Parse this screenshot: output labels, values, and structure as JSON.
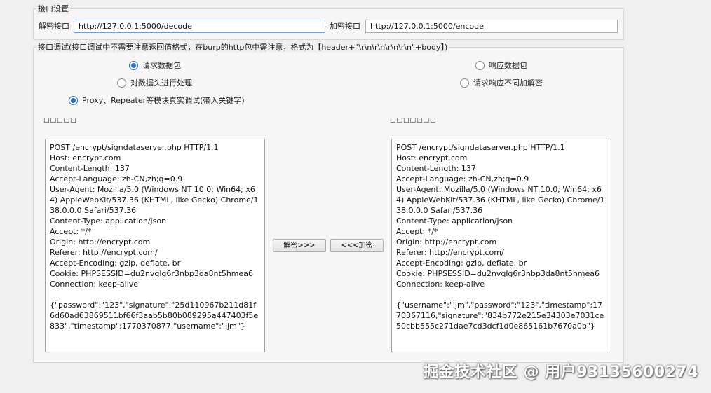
{
  "interface_settings": {
    "title": "接口设置",
    "decode_label": "解密接口",
    "decode_url": "http://127.0.0.1:5000/decode",
    "encode_label": "加密接口",
    "encode_url": "http://127.0.0.1:5000/encode"
  },
  "debug": {
    "title": "接口调试(接口调试中不需要注意返回值格式，在burp的http包中需注意，格式为【header+\"\\r\\n\\r\\n\\r\\n\\r\\n\"+body】)",
    "options": {
      "request_packet": {
        "label": "请求数据包",
        "checked": true
      },
      "response_packet": {
        "label": "响应数据包",
        "checked": false
      },
      "process_header": {
        "label": "对数据头进行处理",
        "checked": false
      },
      "request_response_different": {
        "label": "请求响应不同加解密",
        "checked": false
      },
      "proxy_repeater": {
        "label": "Proxy、Repeater等模块真实调试(带入关键字)",
        "checked": true
      }
    },
    "left_label": "□□□□□",
    "right_label": "□□□□□□□",
    "left_content": "POST /encrypt/signdataserver.php HTTP/1.1\nHost: encrypt.com\nContent-Length: 137\nAccept-Language: zh-CN,zh;q=0.9\nUser-Agent: Mozilla/5.0 (Windows NT 10.0; Win64; x64) AppleWebKit/537.36 (KHTML, like Gecko) Chrome/138.0.0.0 Safari/537.36\nContent-Type: application/json\nAccept: */*\nOrigin: http://encrypt.com\nReferer: http://encrypt.com/\nAccept-Encoding: gzip, deflate, br\nCookie: PHPSESSID=du2nvqlg6r3nbp3da8nt5hmea6\nConnection: keep-alive\n\n{\"password\":\"123\",\"signature\":\"25d110967b211d81f6d60ad63869511bf66f3aab5b80b089295a447403f5e833\",\"timestamp\":1770370877,\"username\":\"ljm\"}",
    "right_content": "POST /encrypt/signdataserver.php HTTP/1.1\nHost: encrypt.com\nContent-Length: 137\nAccept-Language: zh-CN,zh;q=0.9\nUser-Agent: Mozilla/5.0 (Windows NT 10.0; Win64; x64) AppleWebKit/537.36 (KHTML, like Gecko) Chrome/138.0.0.0 Safari/537.36\nContent-Type: application/json\nAccept: */*\nOrigin: http://encrypt.com\nReferer: http://encrypt.com/\nAccept-Encoding: gzip, deflate, br\nCookie: PHPSESSID=du2nvqlg6r3nbp3da8nt5hmea6\nConnection: keep-alive\n\n{\"username\":\"ljm\",\"password\":\"123\",\"timestamp\":1770367116,\"signature\":\"834b772e215e34303e7031ce50cbb555c271dae7cd3dcf1d0e865161b7670a0b\"}",
    "decrypt_button": "解密>>>",
    "encrypt_button": "<<<加密"
  },
  "watermark": "掘金技术社区 @ 用户93135600274"
}
